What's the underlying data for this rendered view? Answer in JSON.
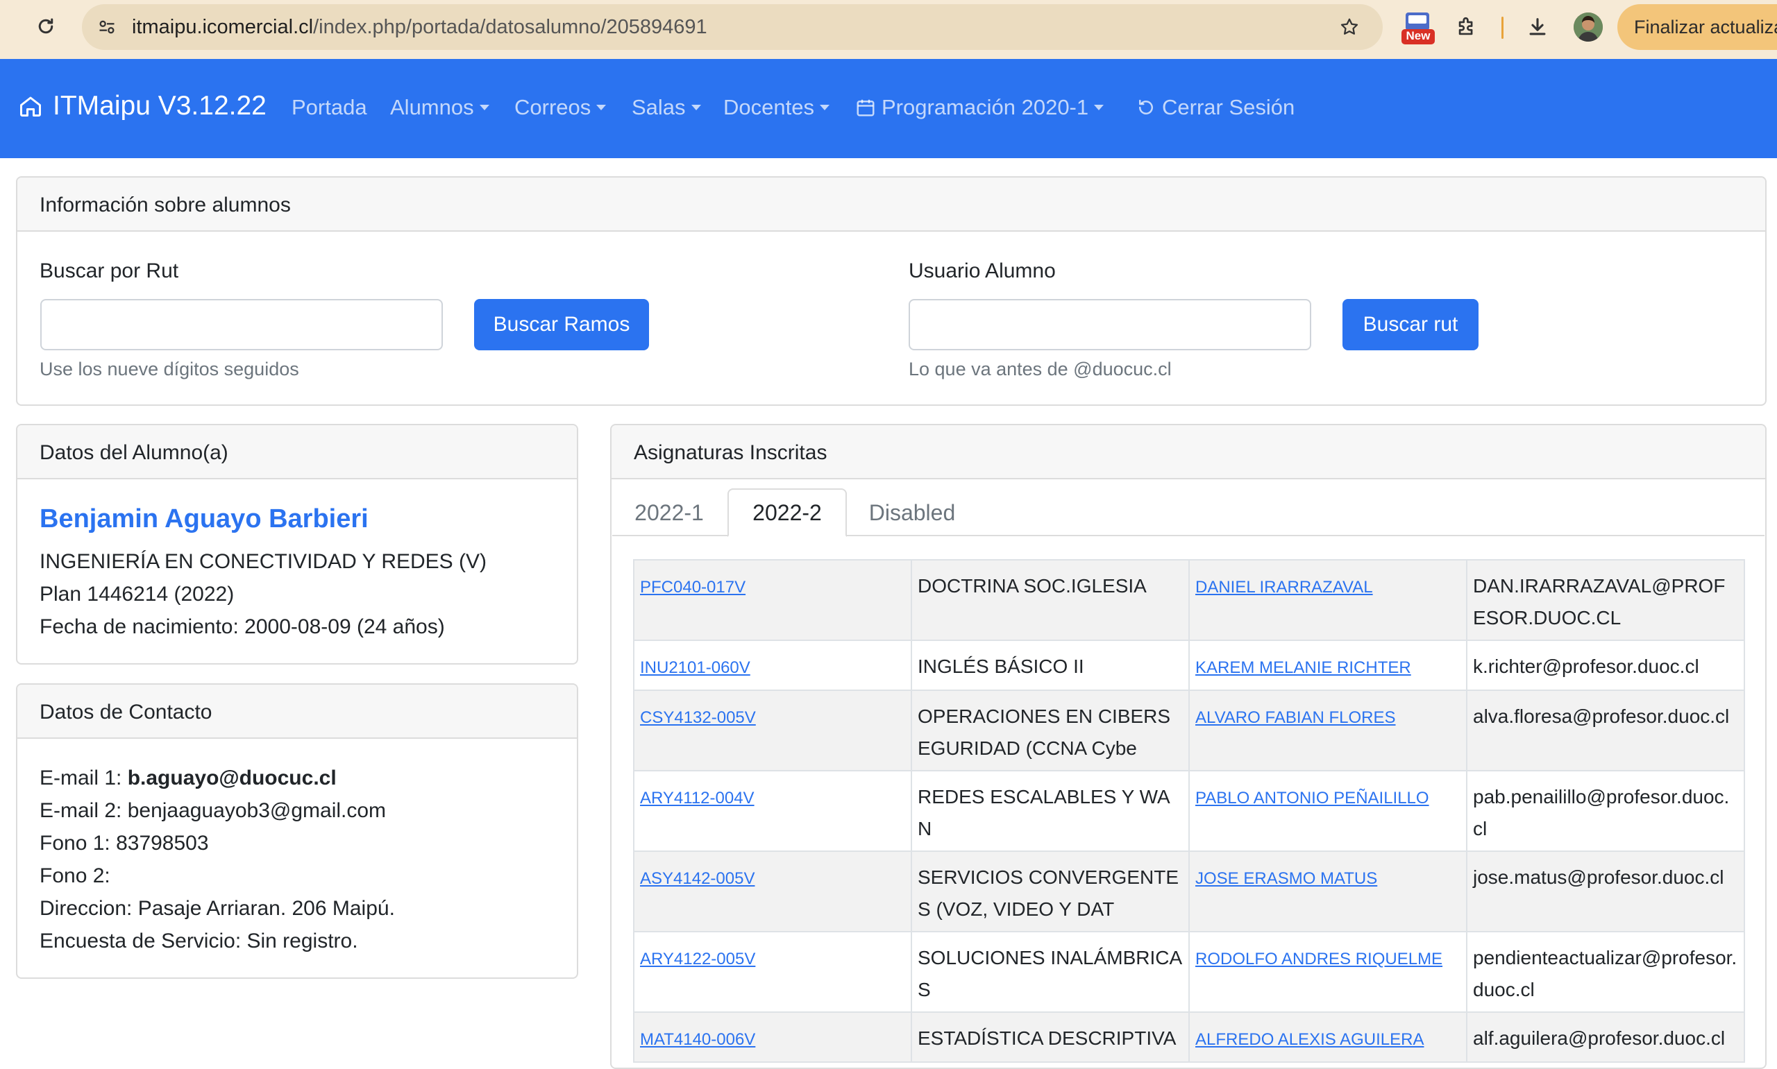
{
  "browser": {
    "url_host": "itmaipu.icomercial.cl",
    "url_path": "/index.php/portada/datosalumno/205894691",
    "new_badge": "New",
    "update_button": "Finalizar actualiza"
  },
  "navbar": {
    "brand": "ITMaipu V3.12.22",
    "items": [
      {
        "label": "Portada"
      },
      {
        "label": "Alumnos"
      },
      {
        "label": "Correos"
      },
      {
        "label": "Salas"
      },
      {
        "label": "Docentes"
      },
      {
        "label": "Programación 2020-1"
      },
      {
        "label": "Cerrar Sesión"
      }
    ]
  },
  "search_card": {
    "title": "Información sobre alumnos",
    "rut_label": "Buscar por Rut",
    "rut_value": "",
    "rut_button": "Buscar Ramos",
    "rut_help": "Use los nueve dígitos seguidos",
    "user_label": "Usuario Alumno",
    "user_value": "",
    "user_button": "Buscar rut",
    "user_help": "Lo que va antes de @duocuc.cl"
  },
  "student_card": {
    "title": "Datos del Alumno(a)",
    "name": "Benjamin Aguayo Barbieri",
    "career": "INGENIERÍA EN CONECTIVIDAD Y REDES (V)",
    "plan": "Plan 1446214 (2022)",
    "birth": "Fecha de nacimiento: 2000-08-09 (24 años)"
  },
  "contact_card": {
    "title": "Datos de Contacto",
    "email1_label": "E-mail 1: ",
    "email1": "b.aguayo@duocuc.cl",
    "email2": "E-mail 2: benjaaguayob3@gmail.com",
    "phone1": "Fono 1: 83798503",
    "phone2": "Fono 2:",
    "address": "Direccion: Pasaje Arriaran. 206 Maipú.",
    "survey": "Encuesta de Servicio: Sin registro."
  },
  "courses_card": {
    "title": "Asignaturas Inscritas",
    "tabs": [
      {
        "label": "2022-1"
      },
      {
        "label": "2022-2"
      },
      {
        "label": "Disabled"
      }
    ],
    "rows": [
      {
        "code": "PFC040-017V",
        "subject": "DOCTRINA SOC.IGLESIA",
        "teacher": "DANIEL IRARRAZAVAL",
        "email": "DAN.IRARRAZAVAL@PROFESOR.DUOC.CL"
      },
      {
        "code": "INU2101-060V",
        "subject": "INGLÉS BÁSICO II",
        "teacher": "KAREM MELANIE RICHTER",
        "email": "k.richter@profesor.duoc.cl"
      },
      {
        "code": "CSY4132-005V",
        "subject": "OPERACIONES EN CIBERSEGURIDAD (CCNA Cybe",
        "teacher": "ALVARO FABIAN FLORES",
        "email": "alva.floresa@profesor.duoc.cl"
      },
      {
        "code": "ARY4112-004V",
        "subject": "REDES ESCALABLES Y WAN",
        "teacher": "PABLO ANTONIO PEÑAILILLO",
        "email": "pab.penailillo@profesor.duoc.cl"
      },
      {
        "code": "ASY4142-005V",
        "subject": "SERVICIOS CONVERGENTES (VOZ, VIDEO Y DAT",
        "teacher": "JOSE ERASMO MATUS",
        "email": "jose.matus@profesor.duoc.cl"
      },
      {
        "code": "ARY4122-005V",
        "subject": "SOLUCIONES INALÁMBRICAS",
        "teacher": "RODOLFO ANDRES RIQUELME",
        "email": "pendienteactualizar@profesor.duoc.cl"
      },
      {
        "code": "MAT4140-006V",
        "subject": "ESTADÍSTICA DESCRIPTIVA",
        "teacher": "ALFREDO ALEXIS AGUILERA",
        "email": "alf.aguilera@profesor.duoc.cl"
      }
    ]
  },
  "colors": {
    "primary": "#2b73f0",
    "browser_bar": "#f6ead6",
    "update_button": "#f3c57a"
  }
}
